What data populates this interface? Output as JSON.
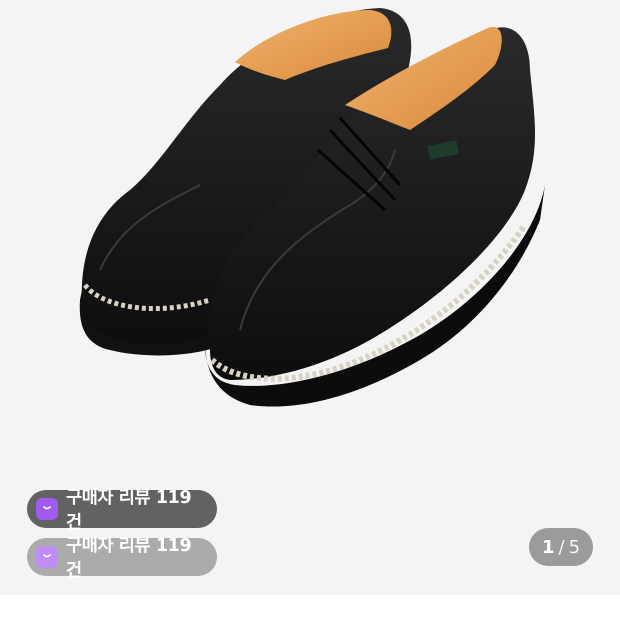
{
  "product": {
    "image_icon": "shoe-photo"
  },
  "review_badges": [
    {
      "label": "구매자 리뷰 119건",
      "icon": "shopping-bag-icon",
      "bg": "#555555",
      "icon_bg": "#a25bf0"
    },
    {
      "label": "구매자 리뷰 119건",
      "icon": "shopping-bag-icon",
      "bg": "#969696",
      "icon_bg": "#c08df7"
    }
  ],
  "pager": {
    "current": "1",
    "separator": "/",
    "total": "5"
  }
}
